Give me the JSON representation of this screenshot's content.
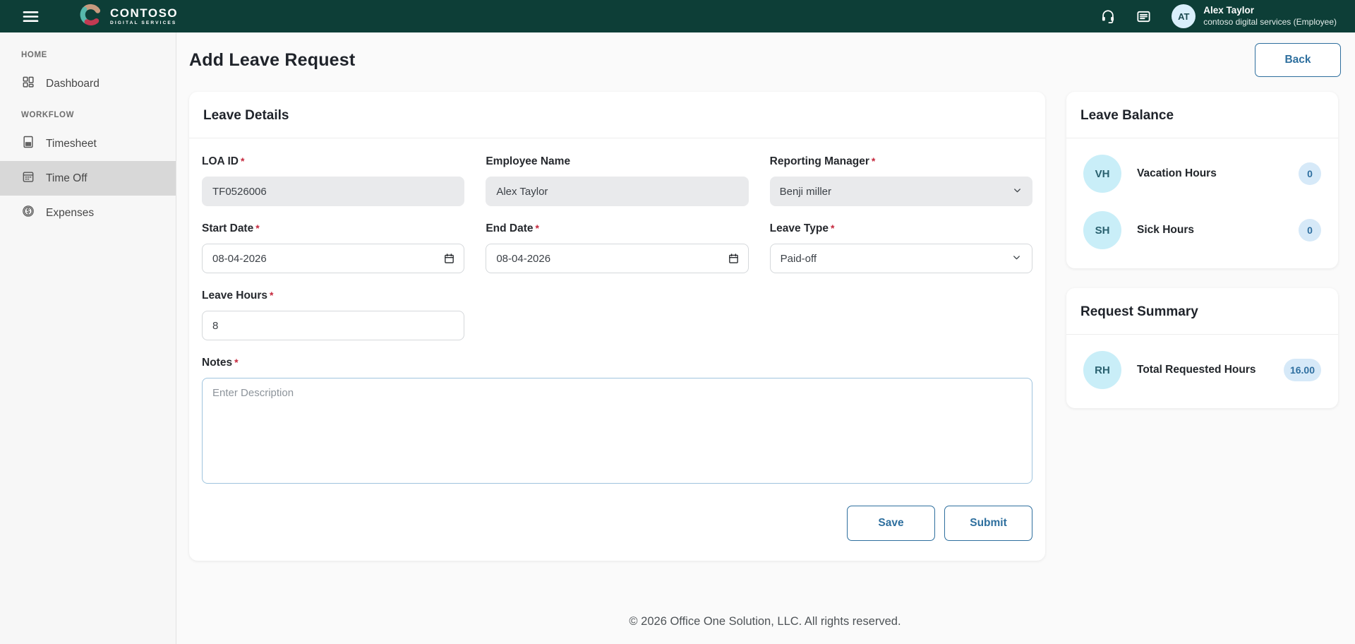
{
  "header": {
    "brand": {
      "name": "CONTOSO",
      "tagline": "DIGITAL SERVICES"
    },
    "user": {
      "initials": "AT",
      "name": "Alex Taylor",
      "subtitle": "contoso digital services (Employee)"
    }
  },
  "sidebar": {
    "sections": [
      {
        "label": "HOME",
        "items": [
          {
            "label": "Dashboard",
            "icon": "dashboard-icon"
          }
        ]
      },
      {
        "label": "WORKFLOW",
        "items": [
          {
            "label": "Timesheet",
            "icon": "timesheet-icon"
          },
          {
            "label": "Time Off",
            "icon": "calendar-icon",
            "active": true
          },
          {
            "label": "Expenses",
            "icon": "dollar-circle-icon"
          }
        ]
      }
    ]
  },
  "page": {
    "title": "Add Leave Request",
    "back_label": "Back"
  },
  "form": {
    "card_title": "Leave Details",
    "required_marker": "*",
    "fields": {
      "loa_id": {
        "label": "LOA ID",
        "required": true,
        "value": "TF0526006",
        "disabled": true
      },
      "employee_name": {
        "label": "Employee Name",
        "required": false,
        "value": "Alex Taylor",
        "disabled": true
      },
      "reporting_manager": {
        "label": "Reporting Manager",
        "required": true,
        "value": "Benji miller"
      },
      "start_date": {
        "label": "Start Date",
        "required": true,
        "value": "08-04-2026"
      },
      "end_date": {
        "label": "End Date",
        "required": true,
        "value": "08-04-2026"
      },
      "leave_type": {
        "label": "Leave Type",
        "required": true,
        "value": "Paid-off"
      },
      "leave_hours": {
        "label": "Leave Hours",
        "required": true,
        "value": "8"
      },
      "notes": {
        "label": "Notes",
        "required": true,
        "placeholder": "Enter Description",
        "value": ""
      }
    },
    "actions": {
      "save": "Save",
      "submit": "Submit"
    }
  },
  "leave_balance": {
    "title": "Leave Balance",
    "items": [
      {
        "initials": "VH",
        "label": "Vacation Hours",
        "value": "0"
      },
      {
        "initials": "SH",
        "label": "Sick Hours",
        "value": "0"
      }
    ]
  },
  "request_summary": {
    "title": "Request Summary",
    "items": [
      {
        "initials": "RH",
        "label": "Total Requested Hours",
        "value": "16.00"
      }
    ]
  },
  "footer": {
    "copyright": "© 2026 Office One Solution, LLC. All rights reserved."
  },
  "icons": {
    "menu": "hamburger-icon",
    "support": "headset-icon",
    "announcements": "news-icon",
    "dashboard": "dashboard-icon",
    "timesheet": "timesheet-icon",
    "time_off": "calendar-icon",
    "expenses": "dollar-circle-icon",
    "date_picker": "calendar-icon",
    "dropdown": "chevron-down-icon"
  },
  "colors": {
    "header_bg": "#0d3e37",
    "accent_blue": "#2e6f9e",
    "required_red": "#c5283d",
    "sidebar_active_bg": "#d8d8d8",
    "header_avatar_bg": "#d9effc",
    "stat_avatar_bg": "#c9eef8",
    "badge_bg": "#d6e9f8",
    "disabled_input_bg": "#e9eaec"
  }
}
